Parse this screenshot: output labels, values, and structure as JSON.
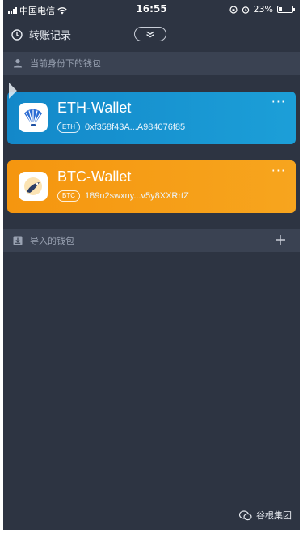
{
  "status": {
    "carrier": "中国电信",
    "time": "16:55",
    "battery": "23%"
  },
  "header": {
    "history_label": "转账记录"
  },
  "sections": {
    "current_wallets": "当前身份下的钱包",
    "imported_wallets": "导入的钱包"
  },
  "wallets": [
    {
      "name": "ETH-Wallet",
      "chip": "ETH",
      "address": "0xf358f43A...A984076f85",
      "color": "#1a97d4"
    },
    {
      "name": "BTC-Wallet",
      "chip": "BTC",
      "address": "189n2swxny...v5y8XXRrtZ",
      "color": "#f69c14"
    }
  ],
  "more_glyph": "···",
  "watermark": "谷根集团"
}
